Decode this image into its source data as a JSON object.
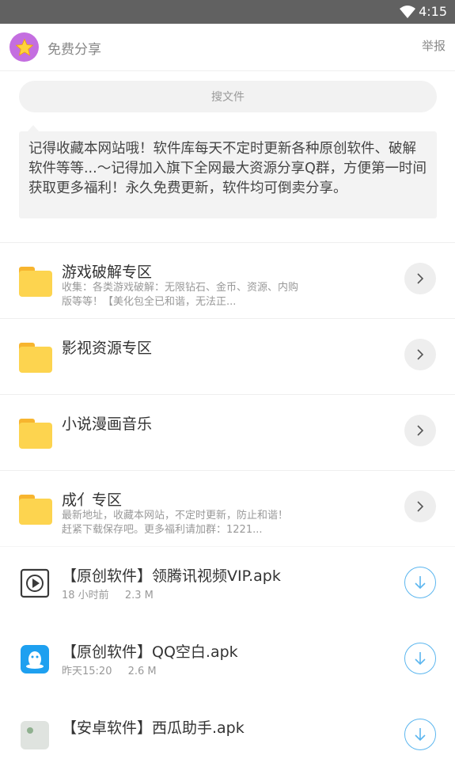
{
  "status": {
    "time": "4:15"
  },
  "header": {
    "title": "免费分享",
    "report": "举报",
    "avatar_icon": "star-icon"
  },
  "search": {
    "placeholder": "搜文件"
  },
  "notice": {
    "text": "记得收藏本网站哦！软件库每天不定时更新各种原创软件、破解软件等等...～记得加入旗下全网最大资源分享Q群，方便第一时间获取更多福利！永久免费更新，软件均可倒卖分享。"
  },
  "folders": [
    {
      "title": "游戏破解专区",
      "desc": "收集：各类游戏破解：无限钻石、金币、资源、内购版等等！【美化包全已和谐，无法正..."
    },
    {
      "title": "影视资源专区",
      "desc": ""
    },
    {
      "title": "小说漫画音乐",
      "desc": ""
    },
    {
      "title": "成亻专区",
      "desc": "最新地址，收藏本网站，不定时更新，防止和谐！赶紧下载保存吧。更多福利请加群：1221..."
    }
  ],
  "files": [
    {
      "title": "【原创软件】领腾讯视频VIP.apk",
      "time": "18 小时前",
      "size": "2.3 M",
      "icon": "video-play-icon"
    },
    {
      "title": "【原创软件】QQ空白.apk",
      "time": "昨天15:20",
      "size": "2.6 M",
      "icon": "qq-penguin-icon"
    },
    {
      "title": "【安卓软件】西瓜助手.apk",
      "time": "",
      "size": "",
      "icon": "app-icon"
    }
  ],
  "colors": {
    "accent": "#5bb6ef",
    "folder": "#fdd44f",
    "avatar": "#c46ee0"
  }
}
